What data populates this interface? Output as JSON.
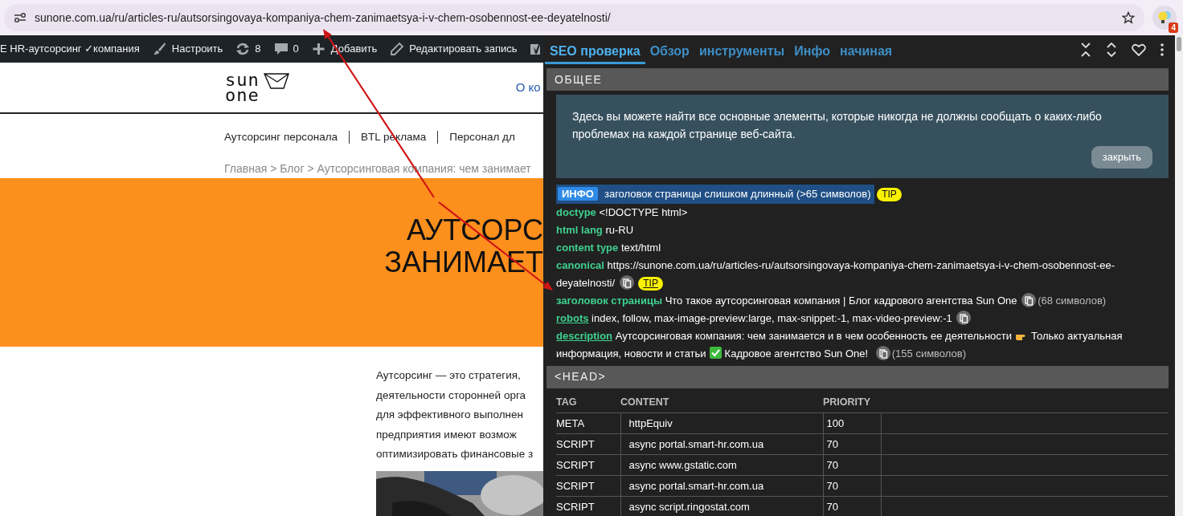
{
  "browser": {
    "url": "sunone.com.ua/ru/articles-ru/autsorsingovaya-kompaniya-chem-zanimaetsya-i-v-chem-osobennost-ee-deyatelnosti/",
    "extension_badge": "4"
  },
  "admin_bar": {
    "items": [
      {
        "kind": "site",
        "label": "E HR-аутсорсинг ✓компания"
      },
      {
        "kind": "customize",
        "label": "Настроить"
      },
      {
        "kind": "updates",
        "label": "8"
      },
      {
        "kind": "comments",
        "label": "0"
      },
      {
        "kind": "new",
        "label": "Добавить"
      },
      {
        "kind": "edit",
        "label": "Редактировать запись"
      },
      {
        "kind": "seo"
      }
    ]
  },
  "site": {
    "logo": [
      "sun",
      "one"
    ],
    "header_link": "О ко",
    "nav": [
      "Аутсорсинг персонала",
      "BTL реклама",
      "Персонал дл"
    ],
    "breadcrumb": "Главная > Блог > Аутсорсинговая компания: чем занимает",
    "hero_title": [
      "АУТСОРС",
      "ЗАНИМАЕТ"
    ],
    "article_lines": [
      "Аутсорсинг — это стратегия,",
      "деятельности сторонней орга",
      "для эффективного выполнен",
      "предприятия имеют возмож",
      "оптимизировать финансовые з"
    ],
    "article_image": {
      "kind": "picture"
    }
  },
  "seo_panel": {
    "tabs": [
      {
        "label": "SEO проверка",
        "selected": true
      },
      {
        "label": "Обзор",
        "selected": false
      },
      {
        "label": "инструменты",
        "selected": false
      },
      {
        "label": "Инфо",
        "selected": false
      },
      {
        "label": "начиная",
        "selected": false
      }
    ],
    "general": {
      "title": "ОБЩЕЕ",
      "intro": "Здесь вы можете найти все основные элементы, которые никогда не должны сообщать о каких-либо проблемах на каждой странице веб-сайта.",
      "close_button": "закрыть",
      "notice": {
        "badge": "ИНФО",
        "text": "заголовок страницы слишком длинный (>65 символов)",
        "tip": "TIP"
      },
      "fields": [
        {
          "key": "doctype",
          "value": "<!DOCTYPE html>"
        },
        {
          "key": "html lang",
          "value": "ru-RU"
        },
        {
          "key": "content type",
          "value": "text/html"
        },
        {
          "key": "canonical",
          "value_parts": [
            "https://sunone.com.ua/ru/articles-ru/autsorsingovaya-kompaniya-chem-zanimaetsya-i-v-chem-osobennost-ee-",
            "deyatelnosti/"
          ],
          "copy": true,
          "tip": "TIP"
        },
        {
          "key": "заголовок страницы",
          "value": "Что такое аутсорсинговая компания | Блог кадрового агентства Sun One",
          "copy": true,
          "count": "(68 символов)"
        },
        {
          "key": "robots",
          "link": true,
          "value": "index, follow, max-image-preview:large, max-snippet:-1, max-video-preview:-1",
          "copy": true
        },
        {
          "key": "description",
          "link": true,
          "value_parts": [
            "Аутсорсинговая компания: чем занимается и в чем особенность ее деятельности",
            "Только актуальная",
            "информация, новости и статьи",
            "Кадровое агентство Sun One!"
          ],
          "copy": true,
          "count": "(155 символов)"
        }
      ]
    },
    "head": {
      "title": "<HEAD>",
      "columns": [
        "TAG",
        "CONTENT",
        "PRIORITY"
      ],
      "rows": [
        {
          "tag": "META",
          "content": "httpEquiv",
          "priority": "100"
        },
        {
          "tag": "SCRIPT",
          "content": "async",
          "link": "portal.smart-hr.com.ua",
          "priority": "70"
        },
        {
          "tag": "SCRIPT",
          "content": "async",
          "link": "www.gstatic.com",
          "priority": "70"
        },
        {
          "tag": "SCRIPT",
          "content": "async",
          "link": "portal.smart-hr.com.ua",
          "priority": "70"
        },
        {
          "tag": "SCRIPT",
          "content": "async",
          "link": "script.ringostat.com",
          "priority": "70"
        }
      ]
    }
  }
}
